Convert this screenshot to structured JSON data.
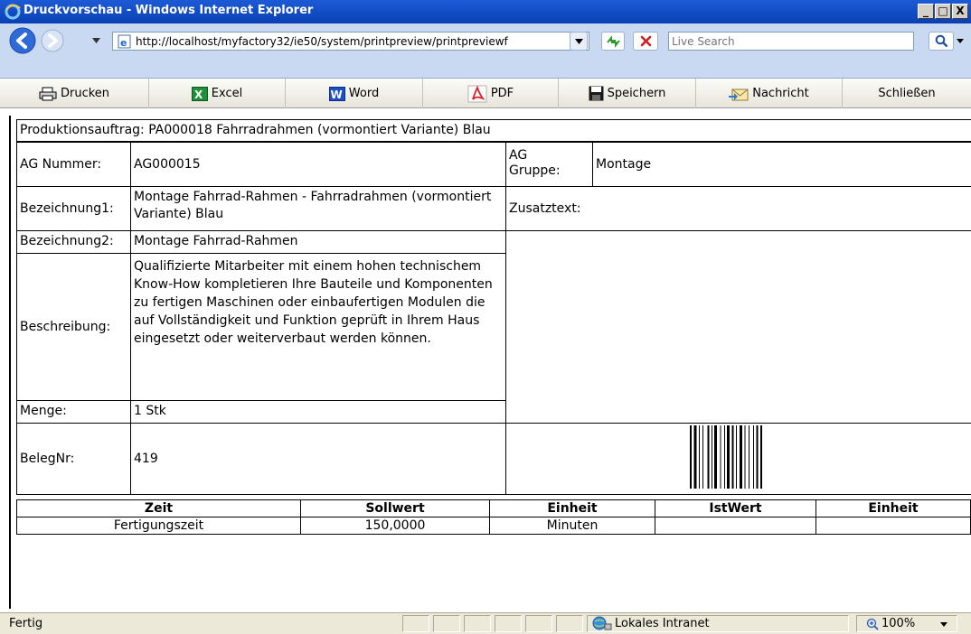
{
  "window": {
    "title": "Druckvorschau - Windows Internet Explorer",
    "minimize": "_",
    "maximize": "□",
    "close": "X"
  },
  "address": {
    "url": "http://localhost/myfactory32/ie50/system/printpreview/printpreviewf",
    "search_placeholder": "Live Search"
  },
  "toolbar": {
    "print": "Drucken",
    "excel": "Excel",
    "word": "Word",
    "pdf": "PDF",
    "save": "Speichern",
    "message": "Nachricht",
    "close": "Schließen"
  },
  "document": {
    "heading": "Produktionsauftrag:  PA000018  Fahrradrahmen (vormontiert Variante) Blau",
    "ag_number_label": "AG Nummer:",
    "ag_number_value": "AG000015",
    "ag_group_label_1": "AG",
    "ag_group_label_2": "Gruppe:",
    "ag_group_value": "Montage",
    "desc1_label": "Bezeichnung1:",
    "desc1_value": "Montage Fahrrad-Rahmen - Fahrradrahmen (vormontiert Variante) Blau",
    "extra_text_label": "Zusatztext:",
    "desc2_label": "Bezeichnung2:",
    "desc2_value": "Montage Fahrrad-Rahmen",
    "description_label": "Beschreibung:",
    "description_value": "Qualifizierte Mitarbeiter mit einem hohen technischem Know-How kompletieren Ihre Bauteile und Komponenten zu fertigen Maschinen oder einbaufertigen Modulen die auf Vollständigkeit und Funktion geprüft in Ihrem Haus eingesetzt oder weiterverbaut werden können.",
    "quantity_label": "Menge:",
    "quantity_value": "1 Stk",
    "doc_number_label": "BelegNr:",
    "doc_number_value": "419"
  },
  "times_table": {
    "headers": [
      "Zeit",
      "Sollwert",
      "Einheit",
      "IstWert",
      "Einheit"
    ],
    "rows": [
      [
        "Fertigungszeit",
        "150,0000",
        "Minuten",
        "",
        ""
      ]
    ]
  },
  "statusbar": {
    "status": "Fertig",
    "zone": "Lokales Intranet",
    "zoom": "100%"
  }
}
